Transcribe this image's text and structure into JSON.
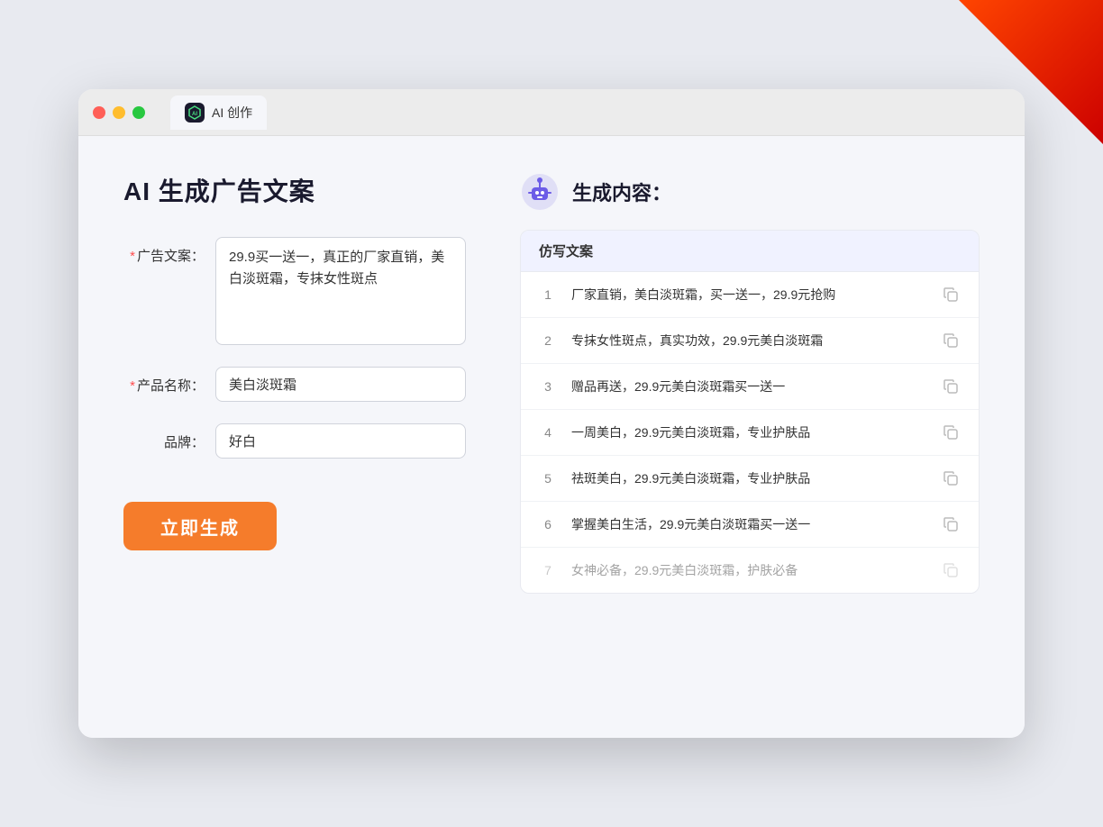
{
  "browser": {
    "tab_label": "AI 创作",
    "tab_icon_text": "AI"
  },
  "page": {
    "title": "AI 生成广告文案",
    "form": {
      "ad_copy_label": "广告文案：",
      "ad_copy_required": "*",
      "ad_copy_value": "29.9买一送一，真正的厂家直销，美白淡斑霜，专抹女性斑点",
      "product_name_label": "产品名称：",
      "product_name_required": "*",
      "product_name_value": "美白淡斑霜",
      "brand_label": "品牌：",
      "brand_value": "好白",
      "generate_btn_label": "立即生成"
    },
    "results": {
      "header_icon_alt": "robot",
      "header_title": "生成内容：",
      "table_header": "仿写文案",
      "items": [
        {
          "num": "1",
          "text": "厂家直销，美白淡斑霜，买一送一，29.9元抢购",
          "dimmed": false
        },
        {
          "num": "2",
          "text": "专抹女性斑点，真实功效，29.9元美白淡斑霜",
          "dimmed": false
        },
        {
          "num": "3",
          "text": "赠品再送，29.9元美白淡斑霜买一送一",
          "dimmed": false
        },
        {
          "num": "4",
          "text": "一周美白，29.9元美白淡斑霜，专业护肤品",
          "dimmed": false
        },
        {
          "num": "5",
          "text": "祛斑美白，29.9元美白淡斑霜，专业护肤品",
          "dimmed": false
        },
        {
          "num": "6",
          "text": "掌握美白生活，29.9元美白淡斑霜买一送一",
          "dimmed": false
        },
        {
          "num": "7",
          "text": "女神必备，29.9元美白淡斑霜，护肤必备",
          "dimmed": true
        }
      ]
    }
  }
}
